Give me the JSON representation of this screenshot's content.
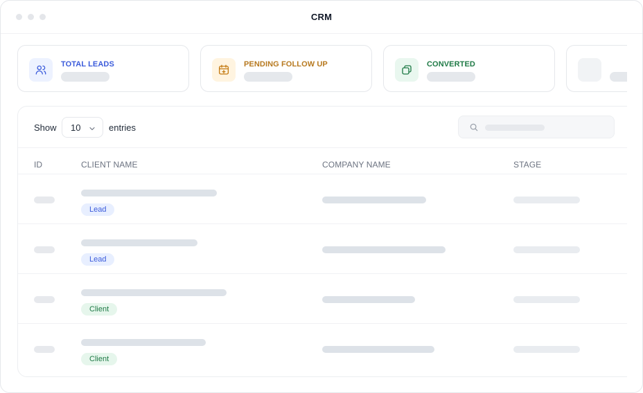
{
  "window": {
    "title": "CRM"
  },
  "stats": [
    {
      "label": "TOTAL LEADS",
      "icon": "users-icon",
      "color": "#3b5bdb",
      "bg": "#edf2ff"
    },
    {
      "label": "PENDING FOLLOW UP",
      "icon": "calendar-plus-icon",
      "color": "#b7791f",
      "bg": "#fff4e0"
    },
    {
      "label": "CONVERTED",
      "icon": "copy-icon",
      "color": "#1f7a46",
      "bg": "#e9f7ef"
    },
    {
      "label": "",
      "icon": "",
      "color": "#e5e7eb",
      "bg": "#f1f3f5"
    }
  ],
  "toolbar": {
    "show_label": "Show",
    "page_size": "10",
    "entries_label": "entries"
  },
  "table": {
    "headers": {
      "id": "ID",
      "client": "CLIENT NAME",
      "company": "COMPANY NAME",
      "stage": "STAGE"
    },
    "rows": [
      {
        "badge": "Lead",
        "badge_type": "lead"
      },
      {
        "badge": "Lead",
        "badge_type": "lead"
      },
      {
        "badge": "Client",
        "badge_type": "client"
      },
      {
        "badge": "Client",
        "badge_type": "client"
      }
    ]
  }
}
